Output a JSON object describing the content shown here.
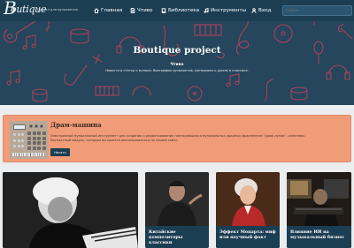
{
  "brand": {
    "logo_initial": "B",
    "logo_rest": "outique",
    "tagline": "Портал для музыкантов"
  },
  "nav": {
    "items": [
      {
        "label": "Главная",
        "icon": "home-icon"
      },
      {
        "label": "Чтиво",
        "icon": "document-icon"
      },
      {
        "label": "Библиотека",
        "icon": "book-icon"
      },
      {
        "label": "Инструменты",
        "icon": "music-note-icon"
      },
      {
        "label": "Вход",
        "icon": "user-icon"
      }
    ]
  },
  "search": {
    "placeholder": "Поиск..."
  },
  "hero": {
    "title": "Boutique project",
    "subtitle": "Чтиво",
    "description": "Новости и статьи о музыке, биографии музыкантов, материалы о джазе и классике."
  },
  "promo": {
    "title": "Драм-машина",
    "text": "Электронный музыкальный инструмент для создания и редактирования повторяющихся музыкальных ударных фрагментов \"драм-лупов\", сэмплами. Бесплатный модуль, которым вы можете воспользоваться на нашем сайте.",
    "button_label": "Начать"
  },
  "cards": [
    {
      "caption": ""
    },
    {
      "caption": "Китайские композиторы классики"
    },
    {
      "caption": "Эффект Моцарта: миф или научный факт"
    },
    {
      "caption": "Влияние ИИ на музыкальный бизнес"
    }
  ],
  "colors": {
    "header": "#1c3e53",
    "hero": "#25465c",
    "hero_pattern": "#c0435b",
    "promo": "#f09c78",
    "caption_bg": "#1c3e53"
  }
}
